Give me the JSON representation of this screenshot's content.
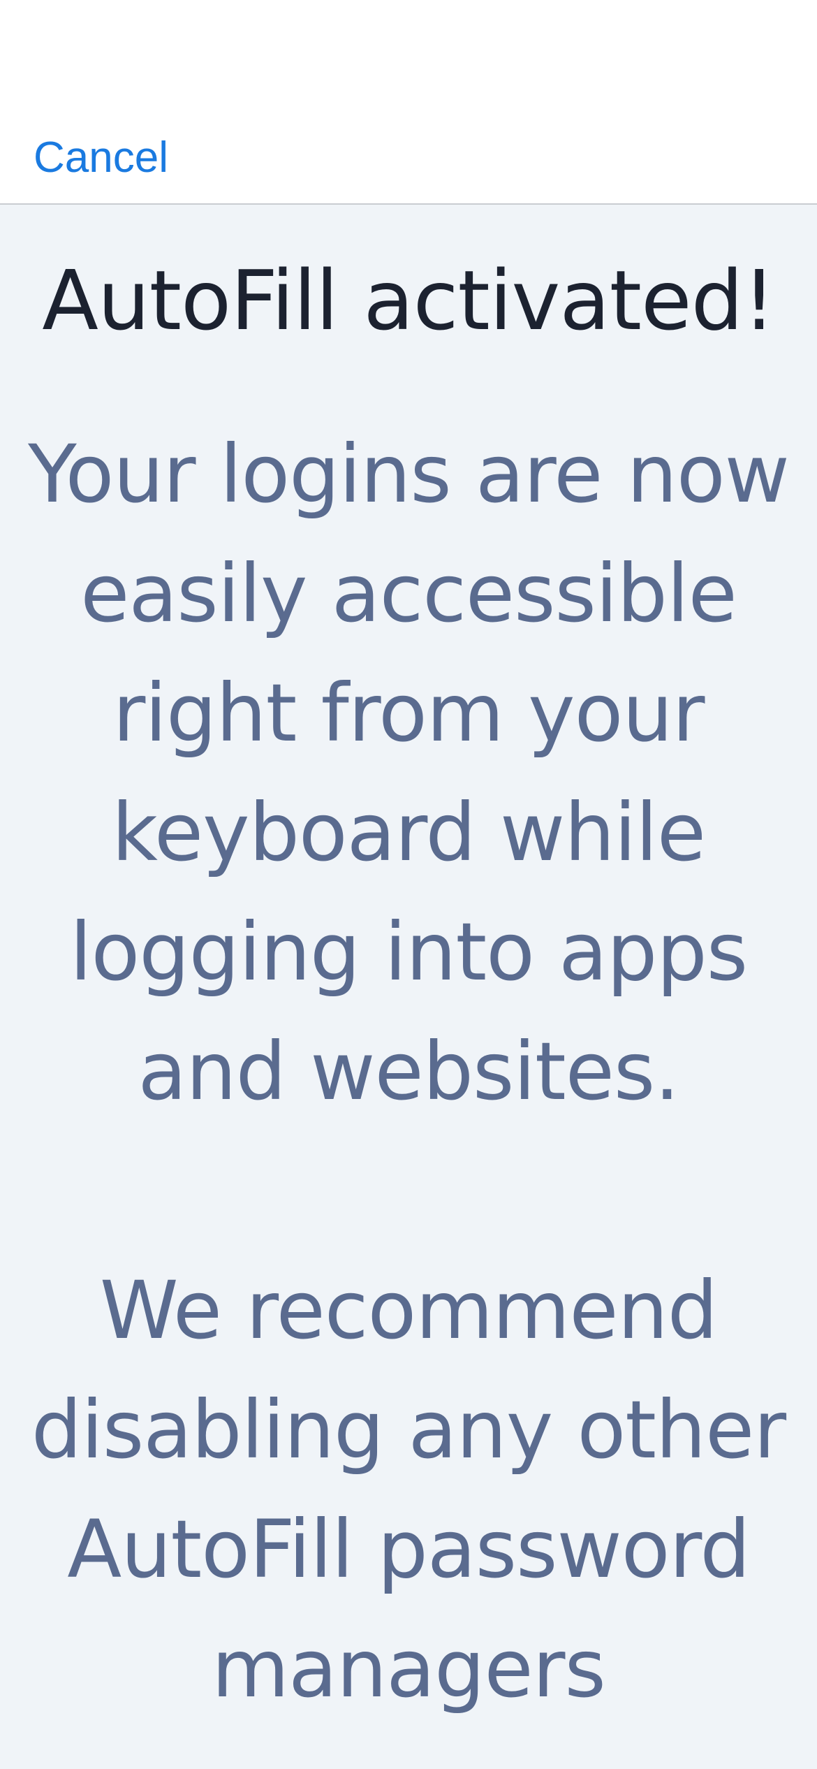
{
  "nav": {
    "cancel_label": "Cancel"
  },
  "content": {
    "title": "AutoFill activated!",
    "body": "Your logins are now easily accessible right from your keyboard while logging into apps and websites.\n\nWe recommend disabling any other AutoFill password managers"
  },
  "colors": {
    "accent": "#1a7ae0",
    "title_text": "#1c2230",
    "body_text": "#5a6b8f",
    "content_background": "#f0f4f8",
    "nav_background": "#ffffff"
  }
}
